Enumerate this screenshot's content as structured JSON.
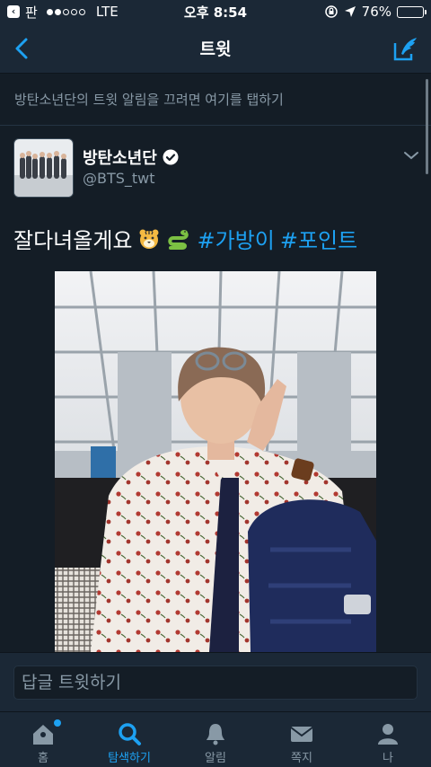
{
  "status_bar": {
    "back_app": "판",
    "carrier": "LTE",
    "time": "오후 8:54",
    "battery": "76%",
    "battery_level": 0.76
  },
  "nav": {
    "title": "트윗"
  },
  "notice": "방탄소년단의 트윗 알림을 끄려면 여기를 탭하기",
  "tweet": {
    "author_name": "방탄소년단",
    "handle": "@BTS_twt",
    "text": "잘다녀올게요",
    "hashtags": [
      "#가방이",
      "#포인트"
    ]
  },
  "reply": {
    "placeholder": "답글 트윗하기"
  },
  "tabs": [
    {
      "label": "홈",
      "icon": "home-icon"
    },
    {
      "label": "탐색하기",
      "icon": "search-icon"
    },
    {
      "label": "알림",
      "icon": "bell-icon"
    },
    {
      "label": "쪽지",
      "icon": "envelope-icon"
    },
    {
      "label": "나",
      "icon": "person-icon"
    }
  ],
  "colors": {
    "accent": "#1da1f2",
    "background": "#141d26",
    "bar": "#1b2836",
    "muted": "#8899a6"
  }
}
